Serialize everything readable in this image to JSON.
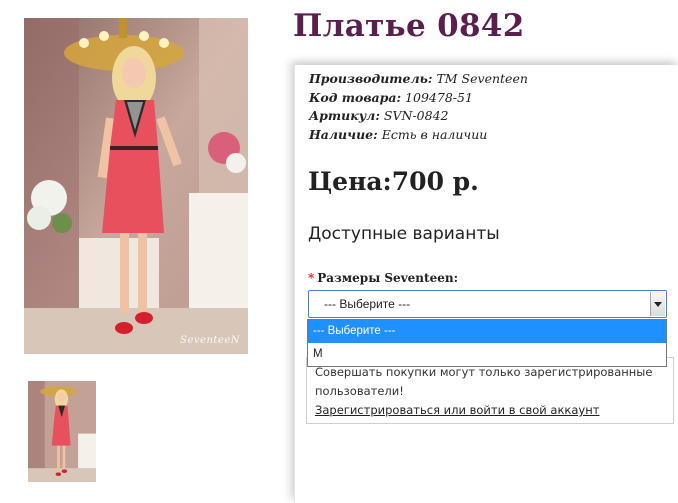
{
  "product": {
    "title": "Платье 0842",
    "image_watermark": "SeventeeN",
    "meta": [
      {
        "label": "Производитель:",
        "value": " ТМ Seventeen"
      },
      {
        "label": "Код товара:",
        "value": " 109478-51"
      },
      {
        "label": "Артикул:",
        "value": " SVN-0842"
      },
      {
        "label": "Наличие:",
        "value": " Есть в наличии"
      }
    ],
    "price": "Цена:700 р."
  },
  "variants": {
    "heading": "Доступные варианты",
    "required_mark": "*",
    "size_label": "Размеры Seventeen:",
    "selected": "--- Выберите ---",
    "options": [
      "--- Выберите ---",
      "M"
    ]
  },
  "notice": {
    "text": "Совершать покупки могут только зарегистрированные пользователи!",
    "link": "Зарегистрироваться или войти в свой аккаунт"
  },
  "colors": {
    "title": "#5a1f4e",
    "dress": "#e8505e",
    "select_border": "#4d7fd0",
    "highlight": "#1e90ff",
    "required": "#e0221b"
  }
}
